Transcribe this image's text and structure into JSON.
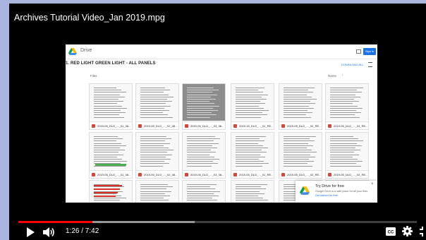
{
  "video": {
    "title": "Archives Tutorial Video_Jan 2019.mpg",
    "time_display": "1:26 / 7:42",
    "progress_fraction": 0.186
  },
  "drive": {
    "brand": "Drive",
    "sign_in": "Sign in",
    "folder_title": "1. RED LIGHT GREEN LIGHT - ALL PANELS",
    "download_all": "DOWNLOAD ALL",
    "files_header": "Files",
    "name_header": "Name",
    "tiles": [
      {
        "name": "2019-05_DLG_..._01_08..."
      },
      {
        "name": "2019-05_DLG_..._02_08..."
      },
      {
        "name": "2019-05_DLG_..._03_08..."
      },
      {
        "name": "2019-15_DLG_..._01_RE..."
      },
      {
        "name": "2019-05_DLG_..._02_RE..."
      },
      {
        "name": "2019-05_DLG_..._03_RE..."
      },
      {
        "name": "2019-05_DLG_..._01_08..."
      },
      {
        "name": "2019-05_DLG_..._02_08..."
      },
      {
        "name": "2019-05_DLG_..._03_08..."
      },
      {
        "name": "2019-05_DLG_..._01_RE..."
      },
      {
        "name": "2019-05_DLG_..._02_RE..."
      },
      {
        "name": "2019-05_DLG_..._03_RE..."
      },
      {
        "name": ""
      },
      {
        "name": ""
      },
      {
        "name": ""
      },
      {
        "name": ""
      },
      {
        "name": ""
      },
      {
        "name": ""
      }
    ],
    "promo": {
      "title": "Try Drive for free",
      "text": "Google Drive is a safe place for all your files",
      "link": "Get started for free"
    }
  },
  "icons": {
    "play": "play-icon",
    "volume": "volume-icon",
    "captions": "captions-icon",
    "settings": "gear-icon",
    "exit_fullscreen": "exit-fullscreen-icon"
  },
  "colors": {
    "progress": "#ff0000",
    "player_bg": "#000000",
    "page_bg": "#a9b4df",
    "drive_blue": "#1a73e8"
  }
}
